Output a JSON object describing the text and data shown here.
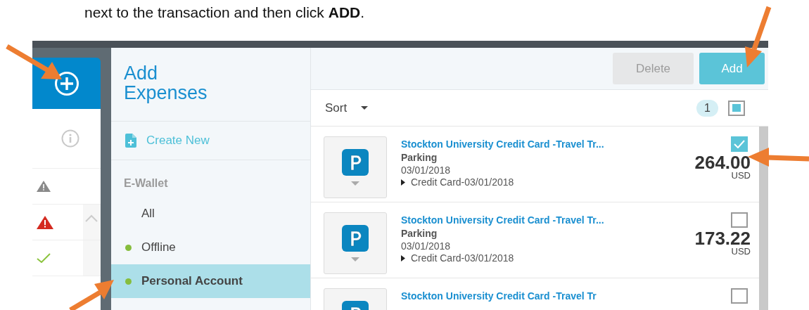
{
  "instruction": {
    "text": "next to the transaction and then click **ADD**."
  },
  "nav": {
    "status_icons": [
      {
        "kind": "info"
      },
      {
        "kind": "warning"
      },
      {
        "kind": "alert"
      },
      {
        "kind": "check"
      }
    ]
  },
  "panel": {
    "title": "Add Expenses",
    "create_new": "Create New",
    "section_label": "E-Wallet",
    "items": [
      {
        "label": "All",
        "selected": false,
        "status_dot": false
      },
      {
        "label": "Offline",
        "selected": false,
        "status_dot": true
      },
      {
        "label": "Personal Account",
        "selected": true,
        "status_dot": true
      }
    ]
  },
  "toolbar": {
    "buttons": [
      {
        "label": "Delete",
        "disabled": true
      },
      {
        "label": "Add",
        "disabled": false
      }
    ]
  },
  "list_header": {
    "sort_label": "Sort",
    "selected_count": "1",
    "select_all_partial": true
  },
  "expenses": [
    {
      "title": "Stockton University Credit Card -Travel Tr...",
      "type": "Parking",
      "date": "03/01/2018",
      "source": "Credit Card-03/01/2018",
      "amount": "264.00",
      "currency": "USD",
      "checked": true
    },
    {
      "title": "Stockton University Credit Card -Travel Tr...",
      "type": "Parking",
      "date": "03/01/2018",
      "source": "Credit Card-03/01/2018",
      "amount": "173.22",
      "currency": "USD",
      "checked": false
    },
    {
      "title": "Stockton University Credit Card -Travel Tr",
      "checked": false
    }
  ]
}
